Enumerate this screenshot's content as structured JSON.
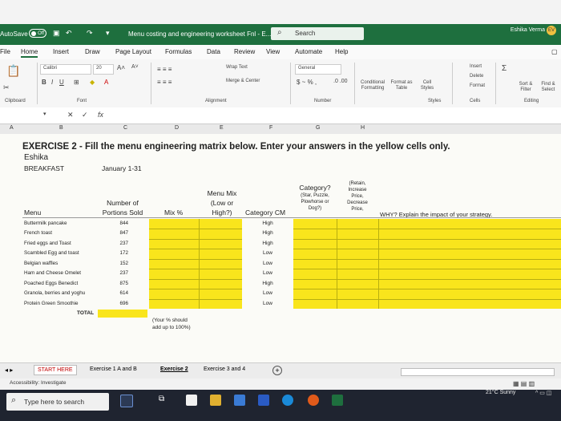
{
  "titlebar": {
    "autosave": "AutoSave",
    "autosave_state": "Off",
    "doc_title": "Menu costing and engineering worksheet Fnl - E...",
    "search": "Search",
    "user": "Eshika Verma",
    "user_initials": "EV"
  },
  "menu": [
    "File",
    "Home",
    "Insert",
    "Draw",
    "Page Layout",
    "Formulas",
    "Data",
    "Review",
    "View",
    "Automate",
    "Help"
  ],
  "ribbon": {
    "font_name": "Calibri",
    "font_size": "20",
    "wrap_text": "Wrap Text",
    "merge_center": "Merge & Center",
    "number_format": "General",
    "conditional_formatting": "Conditional Formatting",
    "format_as_table": "Format as Table",
    "cell_styles": "Cell Styles",
    "insert": "Insert",
    "delete": "Delete",
    "format": "Format",
    "sort_filter": "Sort & Filter",
    "find_select": "Find & Select",
    "groups": {
      "clipboard": "Clipboard",
      "font": "Font",
      "alignment": "Alignment",
      "number": "Number",
      "styles": "Styles",
      "cells": "Cells",
      "editing": "Editing"
    }
  },
  "formula_bar": {
    "cancel": "✕",
    "confirm": "✓",
    "fx": "fx"
  },
  "columns": [
    "A",
    "B",
    "C",
    "D",
    "E",
    "F",
    "G",
    "H"
  ],
  "sheet": {
    "title": "EXERCISE 2 - Fill the menu engineering matrix below.  Enter your answers in the yellow cells only.",
    "name": "Eshika",
    "meal": "BREAKFAST",
    "period": "January 1-31",
    "headers": {
      "menu": "Menu",
      "portions": [
        "Number of",
        "Portions Sold"
      ],
      "mix": "Mix %",
      "menu_mix": [
        "Menu Mix",
        "(Low or",
        "High?)"
      ],
      "category_cm": "Category CM",
      "category": [
        "Category?",
        "(Star, Puzzle,",
        "Plowhorse or",
        "Dog?)"
      ],
      "retain": [
        "(Retain,",
        "Increase",
        "Price,",
        "Decrease",
        "Price,"
      ],
      "why": "WHY? Explain the impact of your strategy."
    },
    "rows": [
      {
        "item": "Buttermilk pancake",
        "sold": "844",
        "cm": "High"
      },
      {
        "item": "French toast",
        "sold": "847",
        "cm": "High"
      },
      {
        "item": "Fried eggs and Toast",
        "sold": "237",
        "cm": "High"
      },
      {
        "item": "Scambled Egg and toast",
        "sold": "172",
        "cm": "Low"
      },
      {
        "item": "Belgian waffles",
        "sold": "152",
        "cm": "Low"
      },
      {
        "item": "Ham and Cheese Omelet",
        "sold": "237",
        "cm": "Low"
      },
      {
        "item": "Poached Eggs Benedict",
        "sold": "875",
        "cm": "High"
      },
      {
        "item": "Granola, berries and yoghu",
        "sold": "614",
        "cm": "Low"
      },
      {
        "item": "Protein Green Smoothie",
        "sold": "696",
        "cm": "Low"
      }
    ],
    "total_label": "TOTAL",
    "note": [
      "(Your % should",
      "add up to 100%)"
    ]
  },
  "tabs": [
    "START HERE",
    "Exercise 1 A and B",
    "Exercise 2",
    "Exercise 3 and 4"
  ],
  "status": {
    "accessibility": "Accessibility: Investigate"
  },
  "taskbar": {
    "search_placeholder": "Type here to search",
    "weather": "21°C  Sunny"
  }
}
